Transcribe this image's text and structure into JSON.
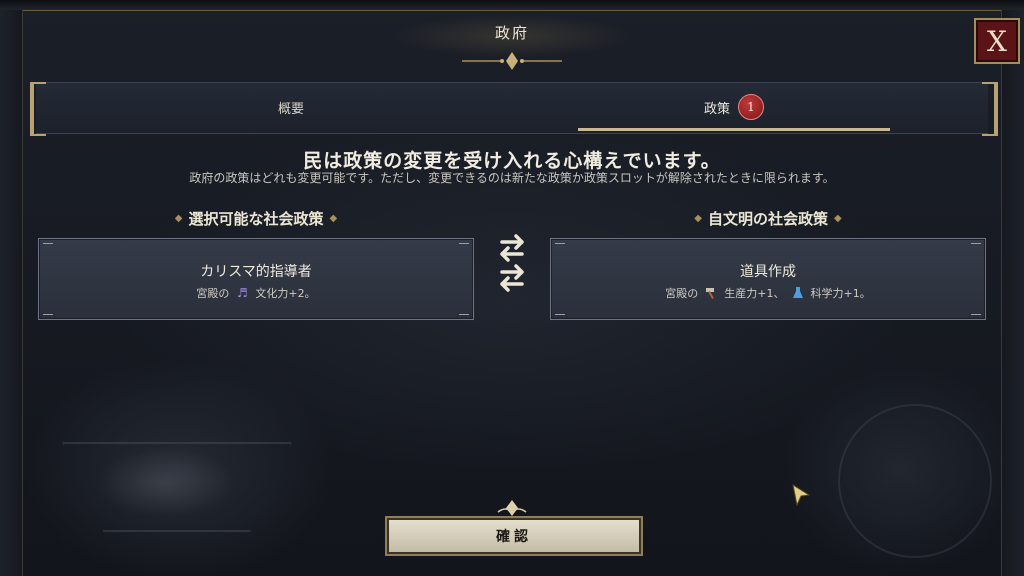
{
  "window": {
    "title": "政府",
    "close_label": "X"
  },
  "tabs": [
    {
      "label": "概要",
      "active": false
    },
    {
      "label": "政策",
      "active": true,
      "badge": "1"
    }
  ],
  "headline": "民は政策の変更を受け入れる心構えでいます。",
  "subline": "政府の政策はどれも変更可能です。ただし、変更できるのは新たな政策か政策スロットが解除されたときに限られます。",
  "columns": {
    "left": {
      "heading": "選択可能な社会政策",
      "card": {
        "title": "カリスマ的指導者",
        "effect_prefix": "宮殿の",
        "effect_icon": "music-note-icon",
        "effect_text": "文化力+2。"
      }
    },
    "right": {
      "heading": "自文明の社会政策",
      "card": {
        "title": "道具作成",
        "effect_prefix": "宮殿の",
        "effect1_icon": "hammer-icon",
        "effect1_text": "生産力+1、",
        "effect2_icon": "flask-icon",
        "effect2_text": "科学力+1。"
      }
    }
  },
  "confirm_label": "確認",
  "colors": {
    "accent_gold": "#b8a272",
    "badge_red": "#9b1c22",
    "close_red": "#5a1418"
  }
}
